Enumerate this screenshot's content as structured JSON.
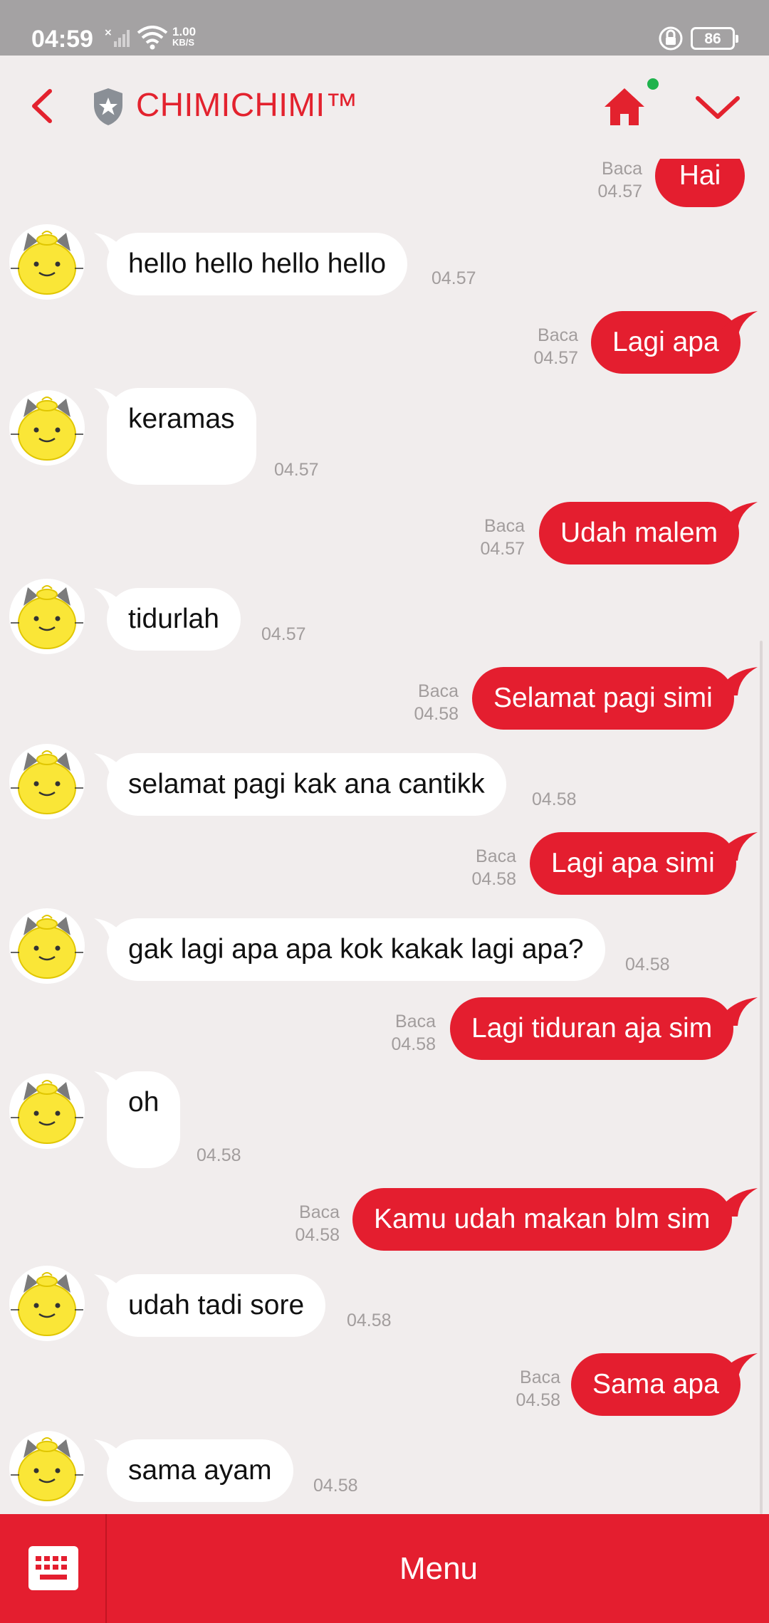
{
  "status_bar": {
    "time": "04:59",
    "net_speed_value": "1.00",
    "net_speed_unit": "KB/S",
    "battery": "86"
  },
  "header": {
    "title": "CHIMICHIMI™",
    "accent_color": "#e3222e",
    "online_dot_color": "#1fb34d",
    "icons": [
      "back-arrow-icon",
      "shield-star-icon",
      "home-icon",
      "chevron-down-icon"
    ]
  },
  "messages": [
    {
      "dir": "out",
      "text": "Hai",
      "status": "Baca",
      "time": "04.57"
    },
    {
      "dir": "in",
      "text": "hello hello hello hello",
      "time": "04.57"
    },
    {
      "dir": "out",
      "text": "Lagi apa",
      "status": "Baca",
      "time": "04.57"
    },
    {
      "dir": "in",
      "text": "keramas",
      "time": "04.57"
    },
    {
      "dir": "out",
      "text": "Udah malem",
      "status": "Baca",
      "time": "04.57"
    },
    {
      "dir": "in",
      "text": "tidurlah",
      "time": "04.57"
    },
    {
      "dir": "out",
      "text": "Selamat pagi simi",
      "status": "Baca",
      "time": "04.58"
    },
    {
      "dir": "in",
      "text": "selamat pagi kak ana cantikk",
      "time": "04.58"
    },
    {
      "dir": "out",
      "text": "Lagi apa simi",
      "status": "Baca",
      "time": "04.58"
    },
    {
      "dir": "in",
      "text": "gak lagi apa apa kok kakak lagi apa?",
      "time": "04.58"
    },
    {
      "dir": "out",
      "text": "Lagi tiduran aja sim",
      "status": "Baca",
      "time": "04.58"
    },
    {
      "dir": "in",
      "text": "oh",
      "time": "04.58"
    },
    {
      "dir": "out",
      "text": "Kamu udah makan blm sim",
      "status": "Baca",
      "time": "04.58"
    },
    {
      "dir": "in",
      "text": "udah tadi sore",
      "time": "04.58"
    },
    {
      "dir": "out",
      "text": "Sama apa",
      "status": "Baca",
      "time": "04.58"
    },
    {
      "dir": "in",
      "text": "sama ayam",
      "time": "04.58"
    }
  ],
  "bottom_bar": {
    "menu_label": "Menu",
    "keyboard_icon": "keyboard-icon",
    "color": "#e41e2f"
  }
}
